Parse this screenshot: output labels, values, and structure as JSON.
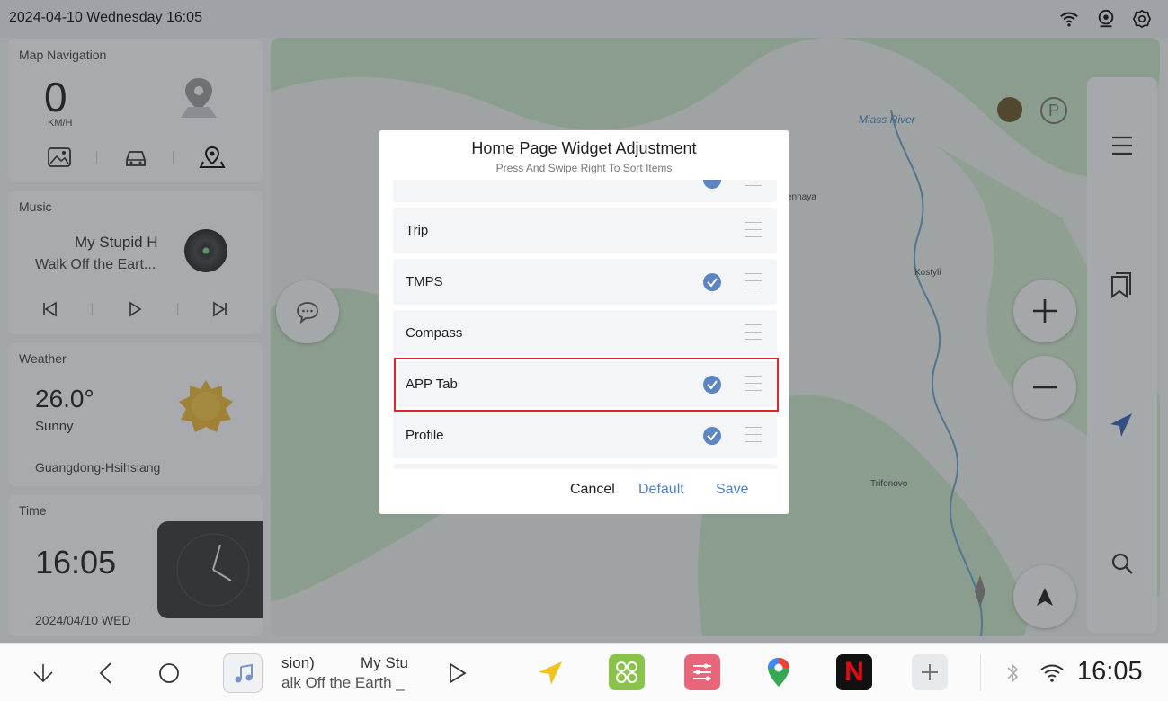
{
  "status": {
    "datetime": "2024-04-10 Wednesday 16:05"
  },
  "widgets": {
    "map": {
      "title": "Map Navigation",
      "speed": "0",
      "unit": "KM/H"
    },
    "music": {
      "title": "Music",
      "song": "My Stupid H",
      "artist": "Walk Off the Eart..."
    },
    "weather": {
      "title": "Weather",
      "temp": "26.0°",
      "condition": "Sunny",
      "location": "Guangdong-Hsihsiang"
    },
    "time": {
      "title": "Time",
      "clock": "16:05",
      "date": "2024/04/10 WED"
    }
  },
  "map_labels": {
    "river": "Miass River",
    "town1": "Kostyli",
    "town2": "Trifonovo",
    "town3": "ennaya"
  },
  "dialog": {
    "title": "Home Page Widget Adjustment",
    "subtitle": "Press And Swipe Right To Sort Items",
    "items": [
      {
        "label": "Trip",
        "checked": false
      },
      {
        "label": "TMPS",
        "checked": true
      },
      {
        "label": "Compass",
        "checked": false
      },
      {
        "label": "APP Tab",
        "checked": true
      },
      {
        "label": "Profile",
        "checked": true
      }
    ],
    "cancel": "Cancel",
    "default": "Default",
    "save": "Save"
  },
  "dock": {
    "music_line1": "sion)",
    "music_line2": "alk Off the Earth _",
    "music_title": "My Stu",
    "clock": "16:05"
  },
  "colors": {
    "accent": "#5c85c4",
    "highlight": "#e0242c"
  }
}
